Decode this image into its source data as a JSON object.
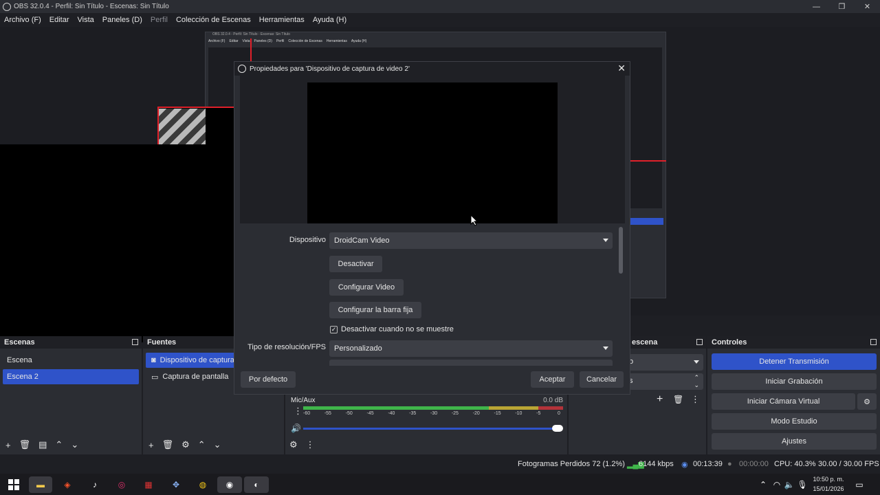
{
  "window": {
    "title": "OBS 32.0.4 - Perfil: Sin Título - Escenas: Sin Título",
    "minimize": "—",
    "maximize": "❐",
    "close": "✕"
  },
  "menu": [
    {
      "label": "Archivo (F)"
    },
    {
      "label": "Editar"
    },
    {
      "label": "Vista"
    },
    {
      "label": "Paneles (D)"
    },
    {
      "label": "Perfil",
      "dim": true
    },
    {
      "label": "Colección de Escenas"
    },
    {
      "label": "Herramientas"
    },
    {
      "label": "Ayuda (H)"
    }
  ],
  "dialog": {
    "title": "Propiedades para 'Dispositivo de captura de video 2'",
    "device_label": "Dispositivo",
    "device_value": "DroidCam Video",
    "deactivate": "Desactivar",
    "configure_video": "Configurar Video",
    "configure_crossbar": "Configurar la barra fija",
    "hide_checkbox": "Desactivar cuando no se muestre",
    "resolution_label": "Tipo de resolución/FPS",
    "resolution_value": "Personalizado",
    "defaults": "Por defecto",
    "accept": "Aceptar",
    "cancel": "Cancelar"
  },
  "scenes": {
    "title": "Escenas",
    "items": [
      "Escena",
      "Escena 2"
    ],
    "selected": 1
  },
  "sources": {
    "title": "Fuentes",
    "items": [
      "Dispositivo de captura",
      "Captura de pantalla"
    ],
    "selected": 0
  },
  "transitions": {
    "title": "escena"
  },
  "mixer": {
    "track": "Mic/Aux",
    "level": "0.0 dB",
    "scale": [
      "-60",
      "-55",
      "-50",
      "-45",
      "-40",
      "-35",
      "-30",
      "-25",
      "-20",
      "-15",
      "-10",
      "-5",
      "0"
    ],
    "volume": 1.0
  },
  "controls": {
    "title": "Controles",
    "stop_stream": "Detener Transmisión",
    "start_recording": "Iniciar Grabación",
    "start_virtual_cam": "Iniciar Cámara Virtual",
    "studio_mode": "Modo Estudio",
    "settings": "Ajustes"
  },
  "status": {
    "dropped": "Fotogramas Perdidos 72 (1.2%)",
    "bitrate": "6144 kbps",
    "stream_time": "00:13:39",
    "rec_time": "00:00:00",
    "cpu": "CPU: 40.3%",
    "fps": "30.00 / 30.00 FPS"
  },
  "clock": {
    "time": "10:50 p. m.",
    "date": "15/01/2026"
  },
  "nested": {
    "title": "OBS 32.0.4 - Perfil: Sin Título - Escenas: Sin Título",
    "menu": [
      "Archivo (F)",
      "Editar",
      "Vista",
      "Paneles (D)",
      "Perfil",
      "Colección de Escenas",
      "Herramientas",
      "Ayuda (H)"
    ]
  }
}
